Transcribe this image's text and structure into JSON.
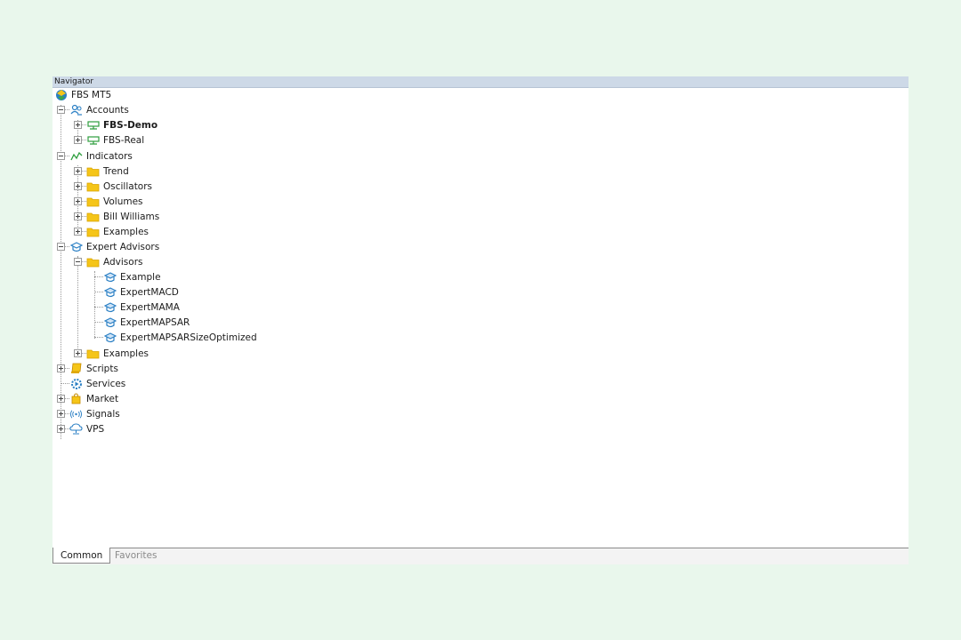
{
  "navigator": {
    "title": "Navigator",
    "root": "FBS MT5",
    "accounts": {
      "label": "Accounts",
      "items": [
        "FBS-Demo",
        "FBS-Real"
      ]
    },
    "indicators": {
      "label": "Indicators",
      "folders": [
        "Trend",
        "Oscillators",
        "Volumes",
        "Bill Williams",
        "Examples"
      ]
    },
    "expert_advisors": {
      "label": "Expert Advisors",
      "advisors_folder": "Advisors",
      "advisors": [
        "Example",
        "ExpertMACD",
        "ExpertMAMA",
        "ExpertMAPSAR",
        "ExpertMAPSARSizeOptimized"
      ],
      "examples_folder": "Examples"
    },
    "scripts": "Scripts",
    "services": "Services",
    "market": "Market",
    "signals": "Signals",
    "vps": "VPS"
  },
  "tabs": {
    "common": "Common",
    "favorites": "Favorites"
  },
  "colors": {
    "folder": "#f5c518",
    "account": "#2e9e3e",
    "advisor": "#2a7fc4",
    "titlebar": "#cdd9e7"
  }
}
